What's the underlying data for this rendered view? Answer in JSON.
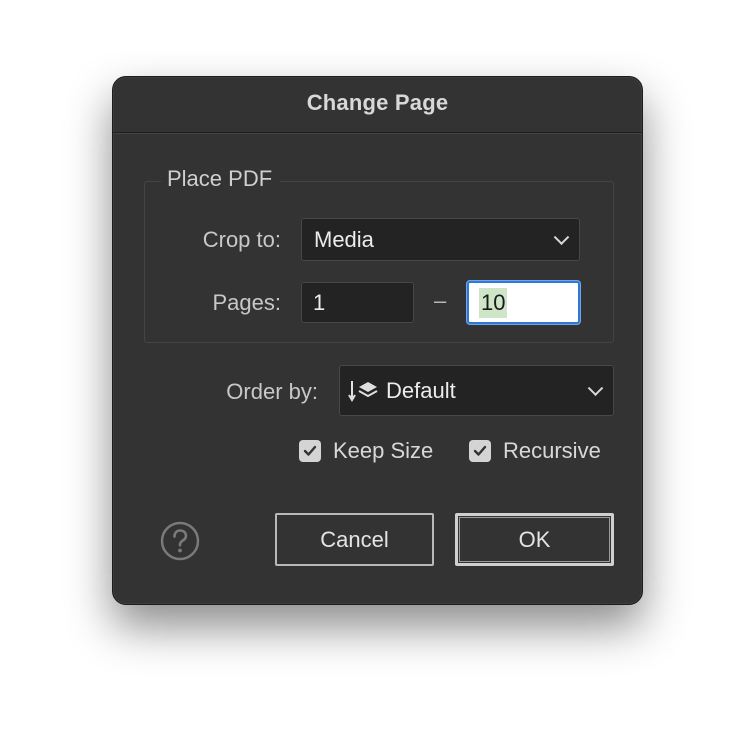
{
  "dialog": {
    "title": "Change Page"
  },
  "place_pdf": {
    "legend": "Place PDF",
    "crop_to_label": "Crop to:",
    "crop_to_value": "Media",
    "pages_label": "Pages:",
    "pages_from": "1",
    "pages_separator": "–",
    "pages_to": "10"
  },
  "order": {
    "label": "Order by:",
    "value": "Default",
    "icon": "sort-layers-icon"
  },
  "options": {
    "keep_size_label": "Keep Size",
    "keep_size_checked": true,
    "recursive_label": "Recursive",
    "recursive_checked": true
  },
  "buttons": {
    "cancel": "Cancel",
    "ok": "OK",
    "help_icon": "question-mark-icon"
  },
  "colors": {
    "dialog_bg": "#333333",
    "focus_ring": "#2e78d6",
    "selection": "#cfe5c8"
  }
}
